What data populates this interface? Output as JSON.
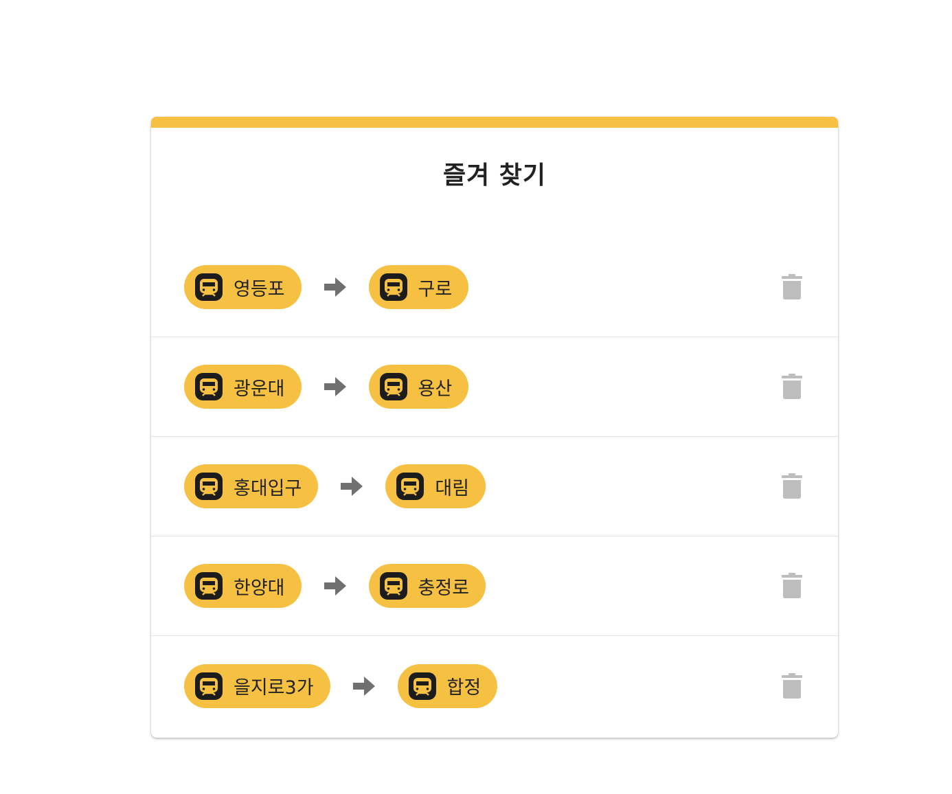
{
  "colors": {
    "accent": "#F6C143",
    "icon_dark": "#1c1c1c",
    "arrow": "#707070",
    "trash": "#bdbdbd"
  },
  "card": {
    "title": "즐겨 찾기"
  },
  "favorites": [
    {
      "from": "영등포",
      "to": "구로"
    },
    {
      "from": "광운대",
      "to": "용산"
    },
    {
      "from": "홍대입구",
      "to": "대림"
    },
    {
      "from": "한양대",
      "to": "충정로"
    },
    {
      "from": "을지로3가",
      "to": "합정"
    }
  ],
  "icons": {
    "station": "subway-icon",
    "direction": "arrow-right-icon",
    "delete": "trash-icon"
  }
}
